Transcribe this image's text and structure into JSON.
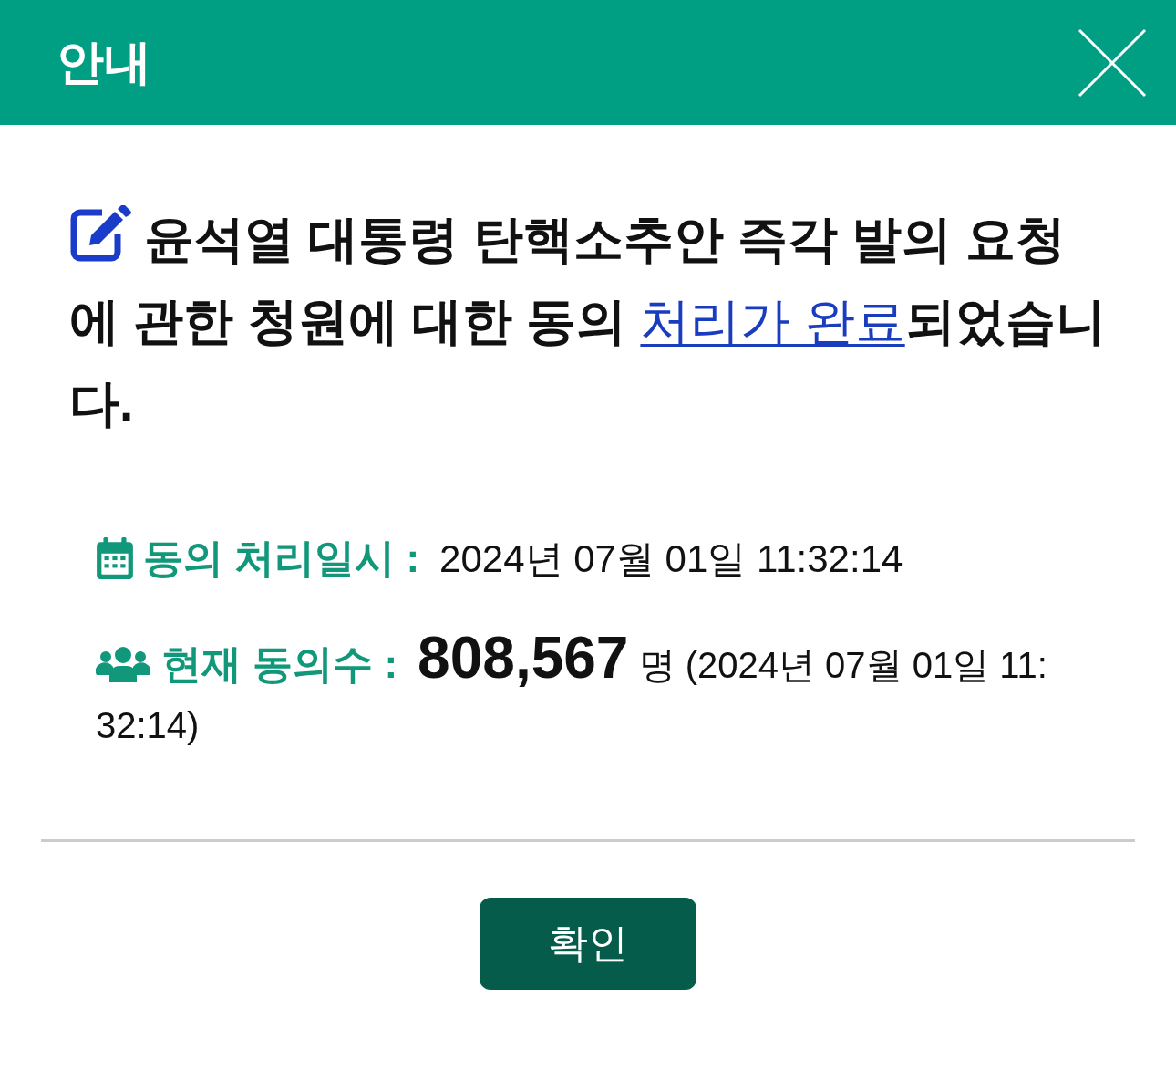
{
  "dialog": {
    "title": "안내"
  },
  "message": {
    "before": "윤석열 대통령 탄핵소추안 즉각 발의 요청에 관한 청원에 대한 동의 ",
    "link": "처리가 완료",
    "after": "되었습니다."
  },
  "details": [
    {
      "kind": "datetime",
      "label": "동의 처리일시 :",
      "value": "2024년 07월 01일 11:32:14"
    },
    {
      "kind": "count",
      "label": "현재 동의수 :",
      "value": "808,567",
      "unit": "명",
      "note": "(2024년 07월 01일 11:32:14)"
    }
  ],
  "buttons": [
    {
      "label": "확인"
    }
  ]
}
